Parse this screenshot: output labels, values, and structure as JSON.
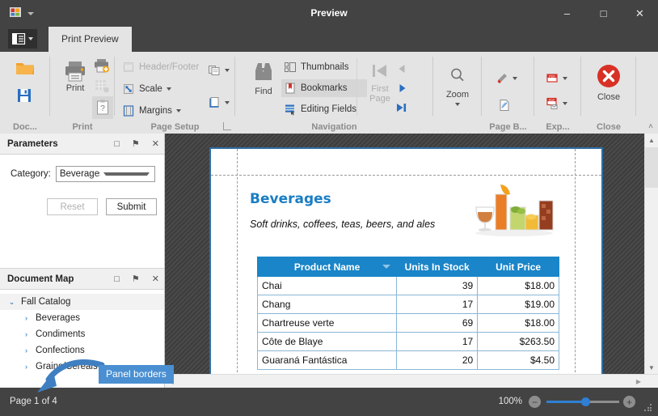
{
  "window": {
    "title": "Preview",
    "minimize": "–",
    "maximize": "□",
    "close": "✕",
    "app_icon": "app-logo-icon",
    "qat_dropdown": "quick-access-dropdown-icon"
  },
  "ribbon": {
    "app_menu_label": "file-menu-icon",
    "tabs": [
      {
        "label": "Print Preview",
        "selected": true
      }
    ],
    "collapse_label": "˄",
    "groups": [
      {
        "name": "Doc...",
        "title": "Doc...",
        "items": [
          {
            "label": "",
            "icon": "open-folder-icon"
          },
          {
            "label": "",
            "icon": "save-icon"
          }
        ]
      },
      {
        "name": "Print",
        "title": "Print",
        "items": [
          {
            "label": "Print",
            "icon": "printer-icon"
          },
          {
            "label": "",
            "icon": "quick-print-icon"
          },
          {
            "label": "",
            "icon": "page-setup-grid-icon",
            "disabled": true
          },
          {
            "label": "",
            "icon": "print-preview-clipboard-icon",
            "selected": true
          }
        ]
      },
      {
        "name": "Page Setup",
        "title": "Page Setup",
        "items": [
          {
            "label": "Header/Footer",
            "icon": "header-footer-icon",
            "disabled": true
          },
          {
            "label": "Scale",
            "icon": "scale-icon",
            "dropdown": true
          },
          {
            "label": "Margins",
            "icon": "margins-icon",
            "dropdown": true
          },
          {
            "label": "",
            "icon": "orientation-icon",
            "dropdown": true
          },
          {
            "label": "",
            "icon": "paper-size-icon",
            "dropdown": true
          }
        ]
      },
      {
        "name": "Navigation",
        "title": "Navigation",
        "items": [
          {
            "label": "Find",
            "icon": "binoculars-icon"
          },
          {
            "label": "Thumbnails",
            "icon": "thumbnails-icon"
          },
          {
            "label": "Bookmarks",
            "icon": "bookmark-icon",
            "selected": true
          },
          {
            "label": "Editing Fields",
            "icon": "editing-fields-icon"
          },
          {
            "label": "First Page",
            "icon": "first-page-icon",
            "disabled": true
          },
          {
            "label": "",
            "icon": "previous-page-icon",
            "disabled": true
          },
          {
            "label": "",
            "icon": "next-page-icon"
          },
          {
            "label": "",
            "icon": "last-page-icon"
          }
        ]
      },
      {
        "name": "Zoom",
        "title": "",
        "items": [
          {
            "label": "Zoom",
            "icon": "magnifier-icon",
            "dropdown": true
          }
        ]
      },
      {
        "name": "Page B...",
        "title": "Page B...",
        "items": [
          {
            "label": "",
            "icon": "page-color-icon",
            "dropdown": true
          },
          {
            "label": "",
            "icon": "watermark-icon"
          }
        ]
      },
      {
        "name": "Exp...",
        "title": "Exp...",
        "items": [
          {
            "label": "",
            "icon": "export-pdf-icon",
            "dropdown": true
          },
          {
            "label": "",
            "icon": "email-pdf-icon",
            "dropdown": true
          }
        ]
      },
      {
        "name": "Close",
        "title": "Close",
        "items": [
          {
            "label": "Close",
            "icon": "close-circle-icon"
          }
        ]
      }
    ]
  },
  "parameters_panel": {
    "title": "Parameters",
    "actions": {
      "float": "□",
      "pin": "⚑",
      "close": "✕"
    },
    "category_label": "Category:",
    "category_value": "Beverages, Condim",
    "reset_label": "Reset",
    "submit_label": "Submit"
  },
  "callout": {
    "text": "Panel borders",
    "color": "#4a8fd1"
  },
  "document_map": {
    "title": "Document Map",
    "actions": {
      "float": "□",
      "pin": "⚑",
      "close": "✕"
    },
    "root": {
      "label": "Fall Catalog",
      "expander": "⌄"
    },
    "children": [
      {
        "label": "Beverages",
        "expander": "›"
      },
      {
        "label": "Condiments",
        "expander": "›"
      },
      {
        "label": "Confections",
        "expander": "›"
      },
      {
        "label": "Grains/Cereals",
        "expander": "›"
      }
    ]
  },
  "document": {
    "heading": "Beverages",
    "subheading": "Soft drinks, coffees, teas, beers, and ales",
    "image": "beverages-photo",
    "table": {
      "columns": [
        "Product Name",
        "Units In Stock",
        "Unit Price"
      ],
      "sorted_column": "Product Name",
      "rows": [
        {
          "product": "Chai",
          "units": "39",
          "price": "$18.00"
        },
        {
          "product": "Chang",
          "units": "17",
          "price": "$19.00"
        },
        {
          "product": "Chartreuse verte",
          "units": "69",
          "price": "$18.00"
        },
        {
          "product": "Côte de Blaye",
          "units": "17",
          "price": "$263.50"
        },
        {
          "product": "Guaraná Fantástica",
          "units": "20",
          "price": "$4.50"
        }
      ]
    }
  },
  "statusbar": {
    "page_status": "Page 1 of 4",
    "zoom_percent": "100%",
    "zoom_out": "−",
    "zoom_in": "+"
  },
  "colors": {
    "chrome_dark": "#434343",
    "ribbon_bg": "#e4e4e4",
    "accent_blue": "#2f7fd4",
    "doc_header_blue": "#1a85c8",
    "doc_title_blue": "#1a7dc4",
    "close_red": "#d93025"
  }
}
